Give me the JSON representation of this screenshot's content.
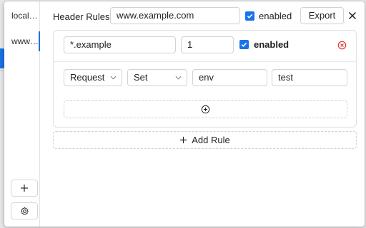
{
  "sidebar": {
    "items": [
      {
        "label": "local…",
        "active": false
      },
      {
        "label": "www…",
        "active": true
      }
    ],
    "add_icon": "plus-icon",
    "settings_icon": "gear-icon"
  },
  "header": {
    "title": "Header Rules",
    "domain_value": "www.example.com",
    "enabled_label": "enabled",
    "export_label": "Export",
    "close_icon": "close-icon"
  },
  "rule": {
    "pattern_value": "*.example",
    "priority_value": "1",
    "enabled_label": "enabled",
    "remove_icon": "remove-circle-icon",
    "modification": {
      "type_value": "Request",
      "action_value": "Set",
      "name_value": "env",
      "value_value": "test"
    },
    "add_modification_icon": "plus-circle-icon"
  },
  "add_rule_label": "Add Rule",
  "colors": {
    "accent": "#1a73e8",
    "danger": "#d93025"
  }
}
